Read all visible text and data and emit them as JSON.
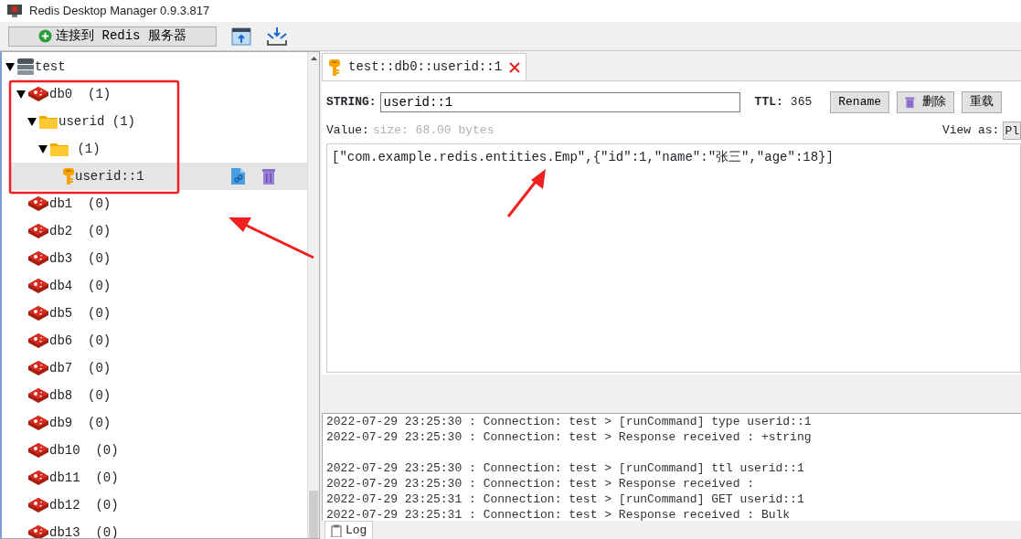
{
  "window": {
    "title": "Redis Desktop Manager 0.9.3.817"
  },
  "toolbar": {
    "connect_button": "连接到 Redis 服务器"
  },
  "tree": [
    {
      "kind": "server",
      "label": "test",
      "expanded": true,
      "selected": false,
      "children": [
        {
          "kind": "db",
          "label": "db0",
          "count": "(1)",
          "expanded": true,
          "selected": false,
          "children": [
            {
              "kind": "folder",
              "label": "userid",
              "count": "(1)",
              "expanded": true,
              "selected": false,
              "children": [
                {
                  "kind": "folder",
                  "count": "(1)",
                  "expanded": true,
                  "selected": false,
                  "children": [
                    {
                      "kind": "key",
                      "label": "userid::1",
                      "selected": true
                    }
                  ]
                }
              ]
            }
          ]
        },
        {
          "kind": "db",
          "label": "db1",
          "count": "(0)",
          "expanded": false,
          "selected": false
        },
        {
          "kind": "db",
          "label": "db2",
          "count": "(0)",
          "expanded": false,
          "selected": false
        },
        {
          "kind": "db",
          "label": "db3",
          "count": "(0)",
          "expanded": false,
          "selected": false
        },
        {
          "kind": "db",
          "label": "db4",
          "count": "(0)",
          "expanded": false,
          "selected": false
        },
        {
          "kind": "db",
          "label": "db5",
          "count": "(0)",
          "expanded": false,
          "selected": false
        },
        {
          "kind": "db",
          "label": "db6",
          "count": "(0)",
          "expanded": false,
          "selected": false
        },
        {
          "kind": "db",
          "label": "db7",
          "count": "(0)",
          "expanded": false,
          "selected": false
        },
        {
          "kind": "db",
          "label": "db8",
          "count": "(0)",
          "expanded": false,
          "selected": false
        },
        {
          "kind": "db",
          "label": "db9",
          "count": "(0)",
          "expanded": false,
          "selected": false
        },
        {
          "kind": "db",
          "label": "db10",
          "count": "(0)",
          "expanded": false,
          "selected": false
        },
        {
          "kind": "db",
          "label": "db11",
          "count": "(0)",
          "expanded": false,
          "selected": false
        },
        {
          "kind": "db",
          "label": "db12",
          "count": "(0)",
          "expanded": false,
          "selected": false
        },
        {
          "kind": "db",
          "label": "db13",
          "count": "(0)",
          "expanded": false,
          "selected": false
        }
      ]
    }
  ],
  "tabs": [
    {
      "label": "test::db0::userid::1",
      "selected": true
    }
  ],
  "key_editor": {
    "type_label": "STRING:",
    "key_name": "userid::1",
    "ttl_label": "TTL:",
    "ttl": "365",
    "buttons": [
      {
        "kind": "plain",
        "label": "Rename"
      },
      {
        "kind": "delete",
        "label": "删除"
      },
      {
        "kind": "plain",
        "label": "重载"
      }
    ],
    "value_label": "Value:",
    "size": "size: 68.00 bytes",
    "view_as_label": "View as:",
    "view_as": "Pl",
    "value": "[\"com.example.redis.entities.Emp\",{\"id\":1,\"name\":\"张三\",\"age\":18}]"
  },
  "log": [
    [
      "2022-07-29 23:25:30 : Connection: test > [runCommand] type userid::1",
      "2022-07-29 23:25:30 : Connection: test > Response received : +string"
    ],
    [
      "2022-07-29 23:25:30 : Connection: test > [runCommand] ttl userid::1",
      "2022-07-29 23:25:30 : Connection: test > Response received :",
      "2022-07-29 23:25:31 : Connection: test > [runCommand] GET userid::1",
      "2022-07-29 23:25:31 : Connection: test > Response received : Bulk"
    ]
  ],
  "log_tab": {
    "label": "Log"
  }
}
